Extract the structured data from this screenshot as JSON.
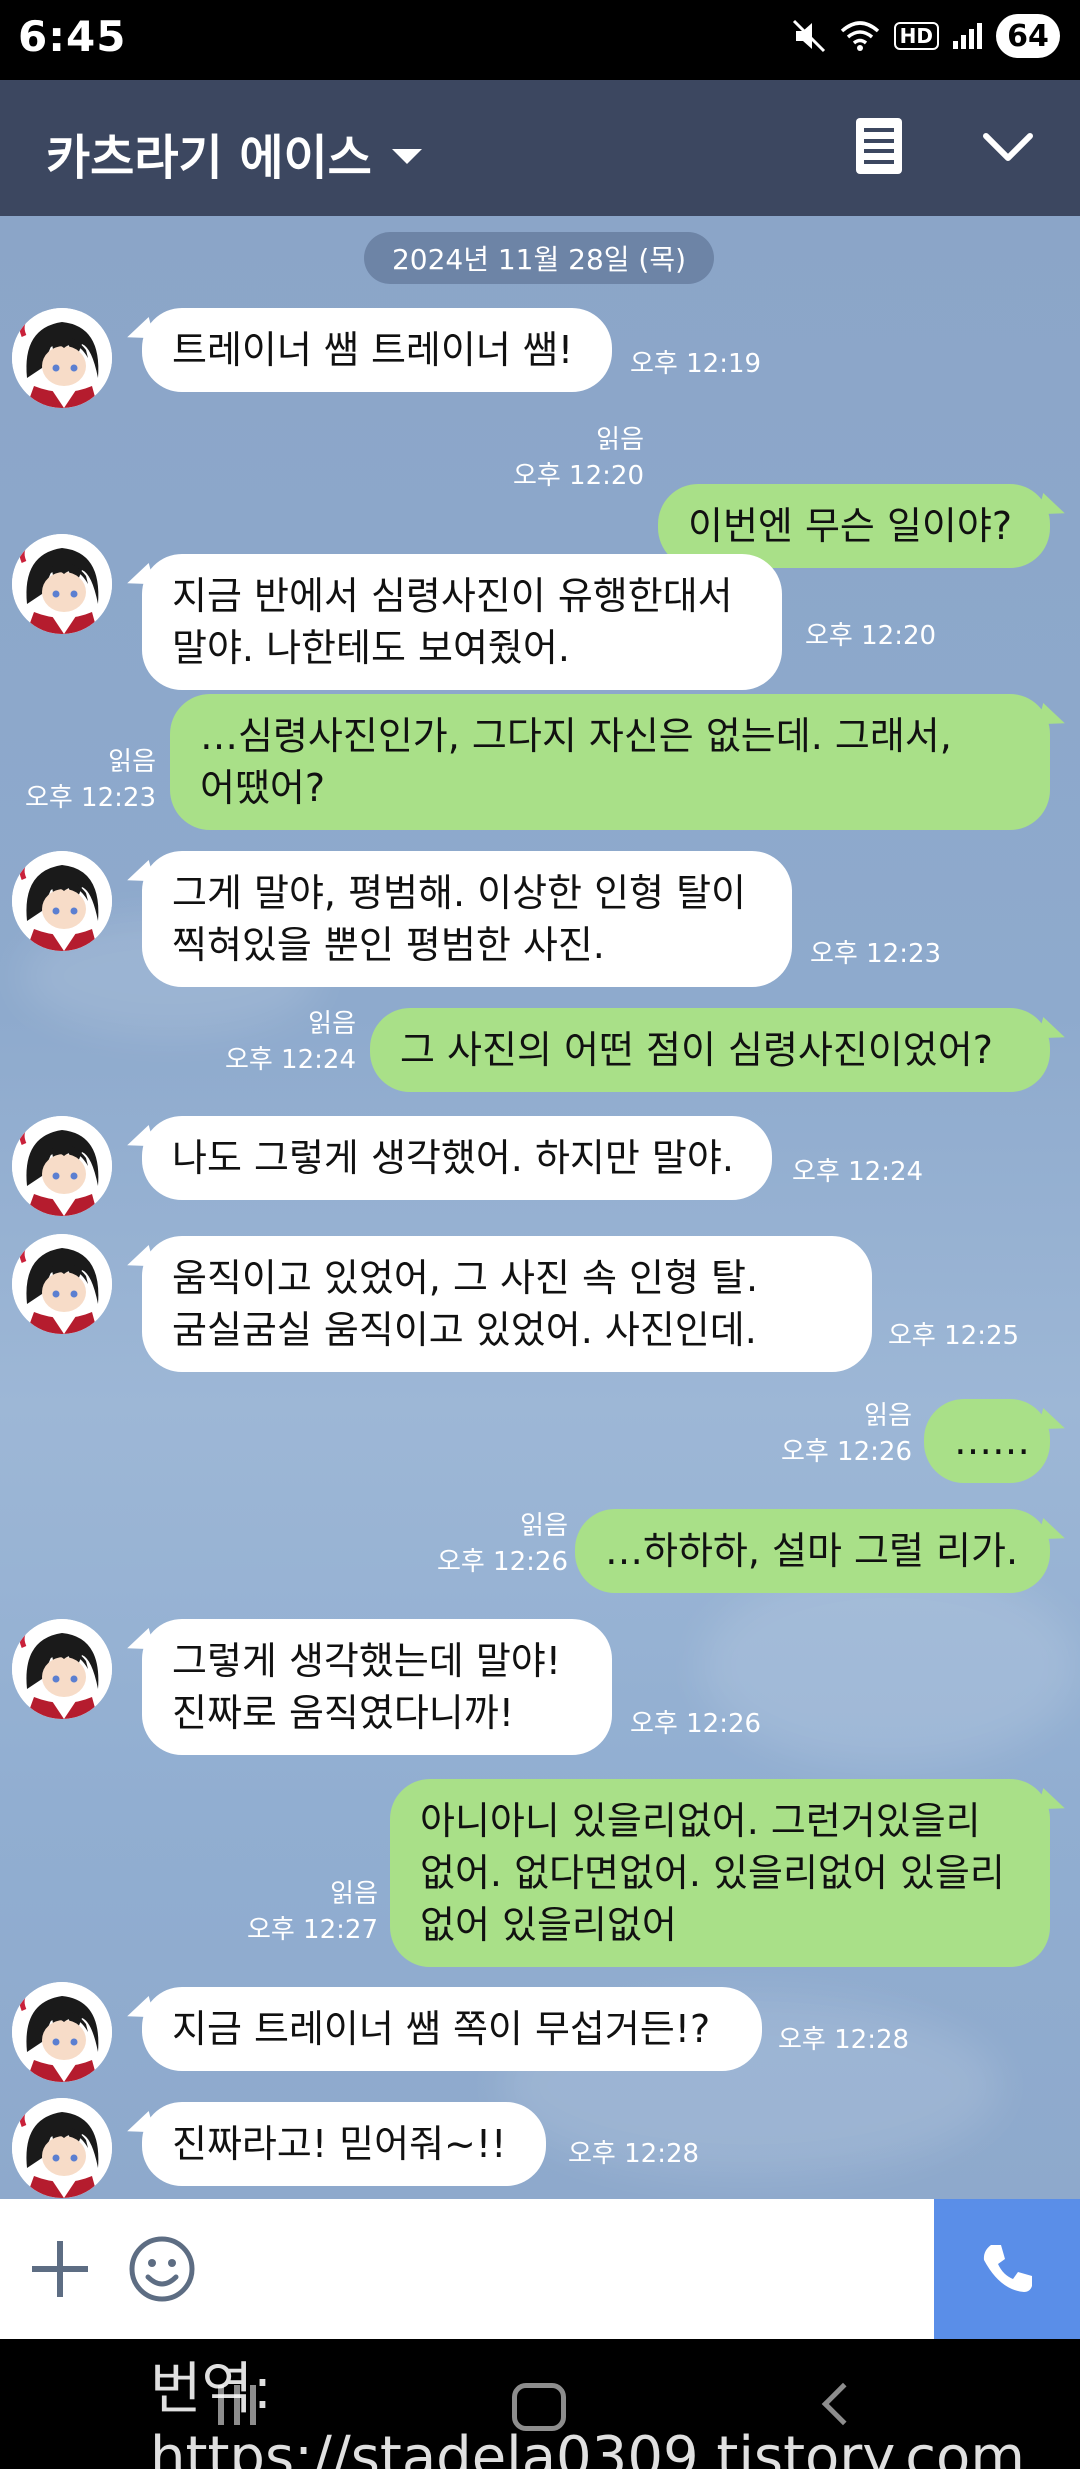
{
  "status_bar": {
    "time": "6:45",
    "hd_label": "HD",
    "battery": "64"
  },
  "header": {
    "title": "카츠라기 에이스"
  },
  "chat": {
    "date": "2024년 11월 28일 (목)",
    "read_label": "읽음",
    "messages": [
      {
        "side": "in",
        "lines": [
          "트레이너 쌤 트레이너 쌤!"
        ],
        "time": "오후 12:19"
      },
      {
        "side": "out",
        "lines": [
          "이번엔 무슨 일이야?"
        ],
        "time": "오후 12:20",
        "read": true
      },
      {
        "side": "in",
        "lines": [
          "지금 반에서 심령사진이 유행한대서",
          "말야. 나한테도 보여줬어."
        ],
        "time": "오후 12:20"
      },
      {
        "side": "out",
        "lines": [
          "…심령사진인가, 그다지 자신은 없는데. 그래서,",
          "어땠어?"
        ],
        "time": "오후 12:23",
        "read": true
      },
      {
        "side": "in",
        "lines": [
          "그게 말야, 평범해. 이상한 인형 탈이",
          "찍혀있을 뿐인 평범한 사진."
        ],
        "time": "오후 12:23"
      },
      {
        "side": "out",
        "lines": [
          "그 사진의 어떤 점이 심령사진이었어?"
        ],
        "time": "오후 12:24",
        "read": true
      },
      {
        "side": "in",
        "lines": [
          "나도 그렇게 생각했어. 하지만 말야."
        ],
        "time": "오후 12:24"
      },
      {
        "side": "in",
        "lines": [
          "움직이고 있었어, 그 사진 속 인형 탈.",
          "굼실굼실 움직이고 있었어. 사진인데."
        ],
        "time": "오후 12:25"
      },
      {
        "side": "out",
        "lines": [
          "……"
        ],
        "time": "오후 12:26",
        "read": true
      },
      {
        "side": "out",
        "lines": [
          "…하하하, 설마 그럴 리가."
        ],
        "time": "오후 12:26",
        "read": true
      },
      {
        "side": "in",
        "lines": [
          "그렇게 생각했는데 말야!",
          "진짜로 움직였다니까!"
        ],
        "time": "오후 12:26"
      },
      {
        "side": "out",
        "lines": [
          "아니아니 있을리없어. 그런거있을리",
          "없어. 없다면없어. 있을리없어 있을리",
          "없어 있을리없어"
        ],
        "time": "오후 12:27",
        "read": true
      },
      {
        "side": "in",
        "lines": [
          "지금 트레이너 쌤 쪽이 무섭거든!?"
        ],
        "time": "오후 12:28"
      },
      {
        "side": "in",
        "lines": [
          "진짜라고! 믿어줘~!!"
        ],
        "time": "오후 12:28"
      }
    ]
  },
  "watermark": "번역: https://stadela0309.tistory.com",
  "colors": {
    "header_bg": "#3c4760",
    "chat_bg": "#8ba5c8",
    "incoming_bubble": "#ffffff",
    "outgoing_bubble": "#a9e088",
    "call_button": "#5a8ee8"
  },
  "icons": [
    "mute-icon",
    "wifi-icon",
    "signal-icon",
    "battery-icon",
    "notes-icon",
    "chevron-down-icon",
    "plus-icon",
    "emoji-icon",
    "phone-icon",
    "nav-recents-icon",
    "nav-home-icon",
    "nav-back-icon"
  ]
}
